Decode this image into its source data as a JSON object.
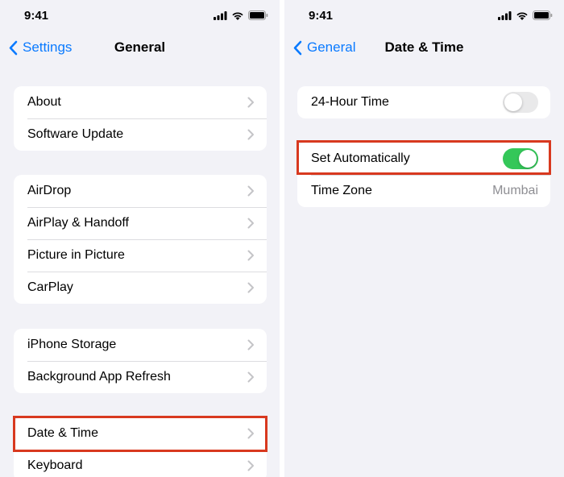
{
  "left_screen": {
    "status_time": "9:41",
    "nav": {
      "back_label": "Settings",
      "title": "General"
    },
    "groups": [
      [
        "About",
        "Software Update"
      ],
      [
        "AirDrop",
        "AirPlay & Handoff",
        "Picture in Picture",
        "CarPlay"
      ],
      [
        "iPhone Storage",
        "Background App Refresh"
      ],
      [
        "Date & Time",
        "Keyboard"
      ]
    ],
    "highlighted_item": "Date & Time"
  },
  "right_screen": {
    "status_time": "9:41",
    "nav": {
      "back_label": "General",
      "title": "Date & Time"
    },
    "hour24": {
      "label": "24-Hour Time",
      "enabled": false
    },
    "set_automatically": {
      "label": "Set Automatically",
      "enabled": true
    },
    "time_zone": {
      "label": "Time Zone",
      "value": "Mumbai"
    },
    "highlighted_item": "Set Automatically"
  },
  "colors": {
    "accent": "#0a7aff",
    "toggle_on": "#34c759",
    "toggle_off": "#e9e9ea",
    "highlight": "#d8391f",
    "background": "#f2f2f7"
  },
  "icons": [
    "signal-icon",
    "wifi-icon",
    "battery-icon",
    "back-chevron-icon",
    "chevron-right-icon"
  ]
}
